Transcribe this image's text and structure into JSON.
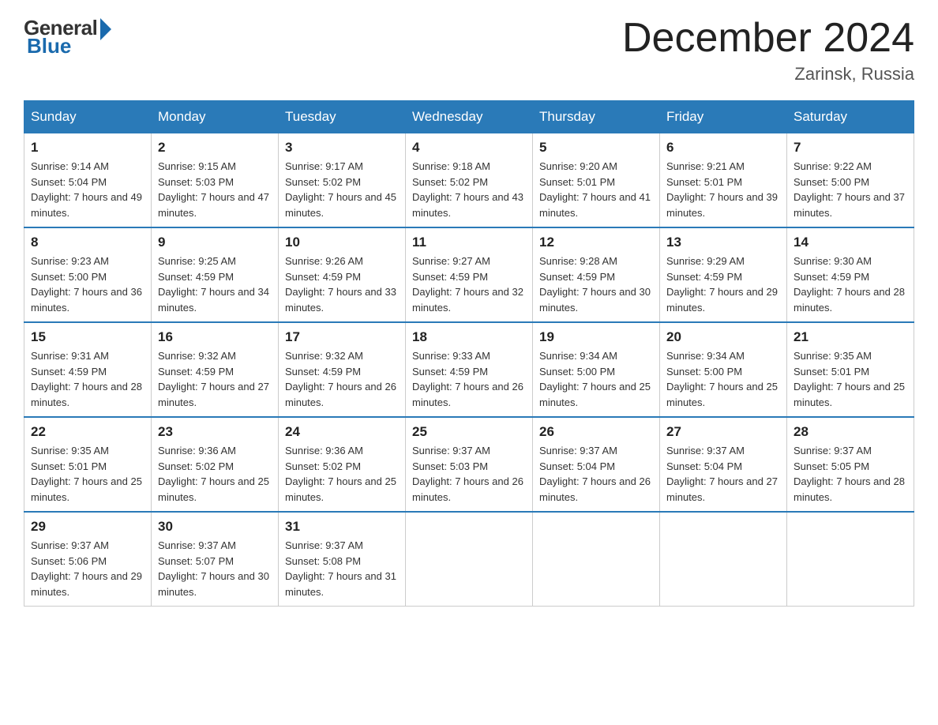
{
  "header": {
    "logo_general": "General",
    "logo_blue": "Blue",
    "title": "December 2024",
    "location": "Zarinsk, Russia"
  },
  "days_of_week": [
    "Sunday",
    "Monday",
    "Tuesday",
    "Wednesday",
    "Thursday",
    "Friday",
    "Saturday"
  ],
  "weeks": [
    [
      {
        "day": "1",
        "sunrise": "9:14 AM",
        "sunset": "5:04 PM",
        "daylight": "7 hours and 49 minutes."
      },
      {
        "day": "2",
        "sunrise": "9:15 AM",
        "sunset": "5:03 PM",
        "daylight": "7 hours and 47 minutes."
      },
      {
        "day": "3",
        "sunrise": "9:17 AM",
        "sunset": "5:02 PM",
        "daylight": "7 hours and 45 minutes."
      },
      {
        "day": "4",
        "sunrise": "9:18 AM",
        "sunset": "5:02 PM",
        "daylight": "7 hours and 43 minutes."
      },
      {
        "day": "5",
        "sunrise": "9:20 AM",
        "sunset": "5:01 PM",
        "daylight": "7 hours and 41 minutes."
      },
      {
        "day": "6",
        "sunrise": "9:21 AM",
        "sunset": "5:01 PM",
        "daylight": "7 hours and 39 minutes."
      },
      {
        "day": "7",
        "sunrise": "9:22 AM",
        "sunset": "5:00 PM",
        "daylight": "7 hours and 37 minutes."
      }
    ],
    [
      {
        "day": "8",
        "sunrise": "9:23 AM",
        "sunset": "5:00 PM",
        "daylight": "7 hours and 36 minutes."
      },
      {
        "day": "9",
        "sunrise": "9:25 AM",
        "sunset": "4:59 PM",
        "daylight": "7 hours and 34 minutes."
      },
      {
        "day": "10",
        "sunrise": "9:26 AM",
        "sunset": "4:59 PM",
        "daylight": "7 hours and 33 minutes."
      },
      {
        "day": "11",
        "sunrise": "9:27 AM",
        "sunset": "4:59 PM",
        "daylight": "7 hours and 32 minutes."
      },
      {
        "day": "12",
        "sunrise": "9:28 AM",
        "sunset": "4:59 PM",
        "daylight": "7 hours and 30 minutes."
      },
      {
        "day": "13",
        "sunrise": "9:29 AM",
        "sunset": "4:59 PM",
        "daylight": "7 hours and 29 minutes."
      },
      {
        "day": "14",
        "sunrise": "9:30 AM",
        "sunset": "4:59 PM",
        "daylight": "7 hours and 28 minutes."
      }
    ],
    [
      {
        "day": "15",
        "sunrise": "9:31 AM",
        "sunset": "4:59 PM",
        "daylight": "7 hours and 28 minutes."
      },
      {
        "day": "16",
        "sunrise": "9:32 AM",
        "sunset": "4:59 PM",
        "daylight": "7 hours and 27 minutes."
      },
      {
        "day": "17",
        "sunrise": "9:32 AM",
        "sunset": "4:59 PM",
        "daylight": "7 hours and 26 minutes."
      },
      {
        "day": "18",
        "sunrise": "9:33 AM",
        "sunset": "4:59 PM",
        "daylight": "7 hours and 26 minutes."
      },
      {
        "day": "19",
        "sunrise": "9:34 AM",
        "sunset": "5:00 PM",
        "daylight": "7 hours and 25 minutes."
      },
      {
        "day": "20",
        "sunrise": "9:34 AM",
        "sunset": "5:00 PM",
        "daylight": "7 hours and 25 minutes."
      },
      {
        "day": "21",
        "sunrise": "9:35 AM",
        "sunset": "5:01 PM",
        "daylight": "7 hours and 25 minutes."
      }
    ],
    [
      {
        "day": "22",
        "sunrise": "9:35 AM",
        "sunset": "5:01 PM",
        "daylight": "7 hours and 25 minutes."
      },
      {
        "day": "23",
        "sunrise": "9:36 AM",
        "sunset": "5:02 PM",
        "daylight": "7 hours and 25 minutes."
      },
      {
        "day": "24",
        "sunrise": "9:36 AM",
        "sunset": "5:02 PM",
        "daylight": "7 hours and 25 minutes."
      },
      {
        "day": "25",
        "sunrise": "9:37 AM",
        "sunset": "5:03 PM",
        "daylight": "7 hours and 26 minutes."
      },
      {
        "day": "26",
        "sunrise": "9:37 AM",
        "sunset": "5:04 PM",
        "daylight": "7 hours and 26 minutes."
      },
      {
        "day": "27",
        "sunrise": "9:37 AM",
        "sunset": "5:04 PM",
        "daylight": "7 hours and 27 minutes."
      },
      {
        "day": "28",
        "sunrise": "9:37 AM",
        "sunset": "5:05 PM",
        "daylight": "7 hours and 28 minutes."
      }
    ],
    [
      {
        "day": "29",
        "sunrise": "9:37 AM",
        "sunset": "5:06 PM",
        "daylight": "7 hours and 29 minutes."
      },
      {
        "day": "30",
        "sunrise": "9:37 AM",
        "sunset": "5:07 PM",
        "daylight": "7 hours and 30 minutes."
      },
      {
        "day": "31",
        "sunrise": "9:37 AM",
        "sunset": "5:08 PM",
        "daylight": "7 hours and 31 minutes."
      },
      null,
      null,
      null,
      null
    ]
  ]
}
